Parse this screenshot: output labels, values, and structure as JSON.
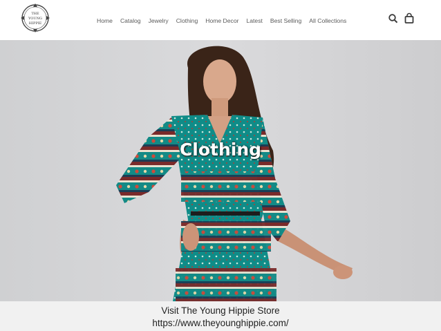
{
  "header": {
    "logo_text": "THE YOUNG HIPPIE",
    "nav": [
      "Home",
      "Catalog",
      "Jewelry",
      "Clothing",
      "Home Decor",
      "Latest",
      "Best Selling",
      "All Collections"
    ],
    "search_icon": "search-icon",
    "cart_icon": "cart-icon"
  },
  "hero": {
    "title": "Clothing"
  },
  "caption": {
    "line1": "Visit The Young Hippie Store",
    "line2": "https://www.theyounghippie.com/"
  },
  "colors": {
    "nav_text": "#5a5a5a",
    "dress_teal": "#0f8a86",
    "caption_bg": "#f1f1f1"
  }
}
